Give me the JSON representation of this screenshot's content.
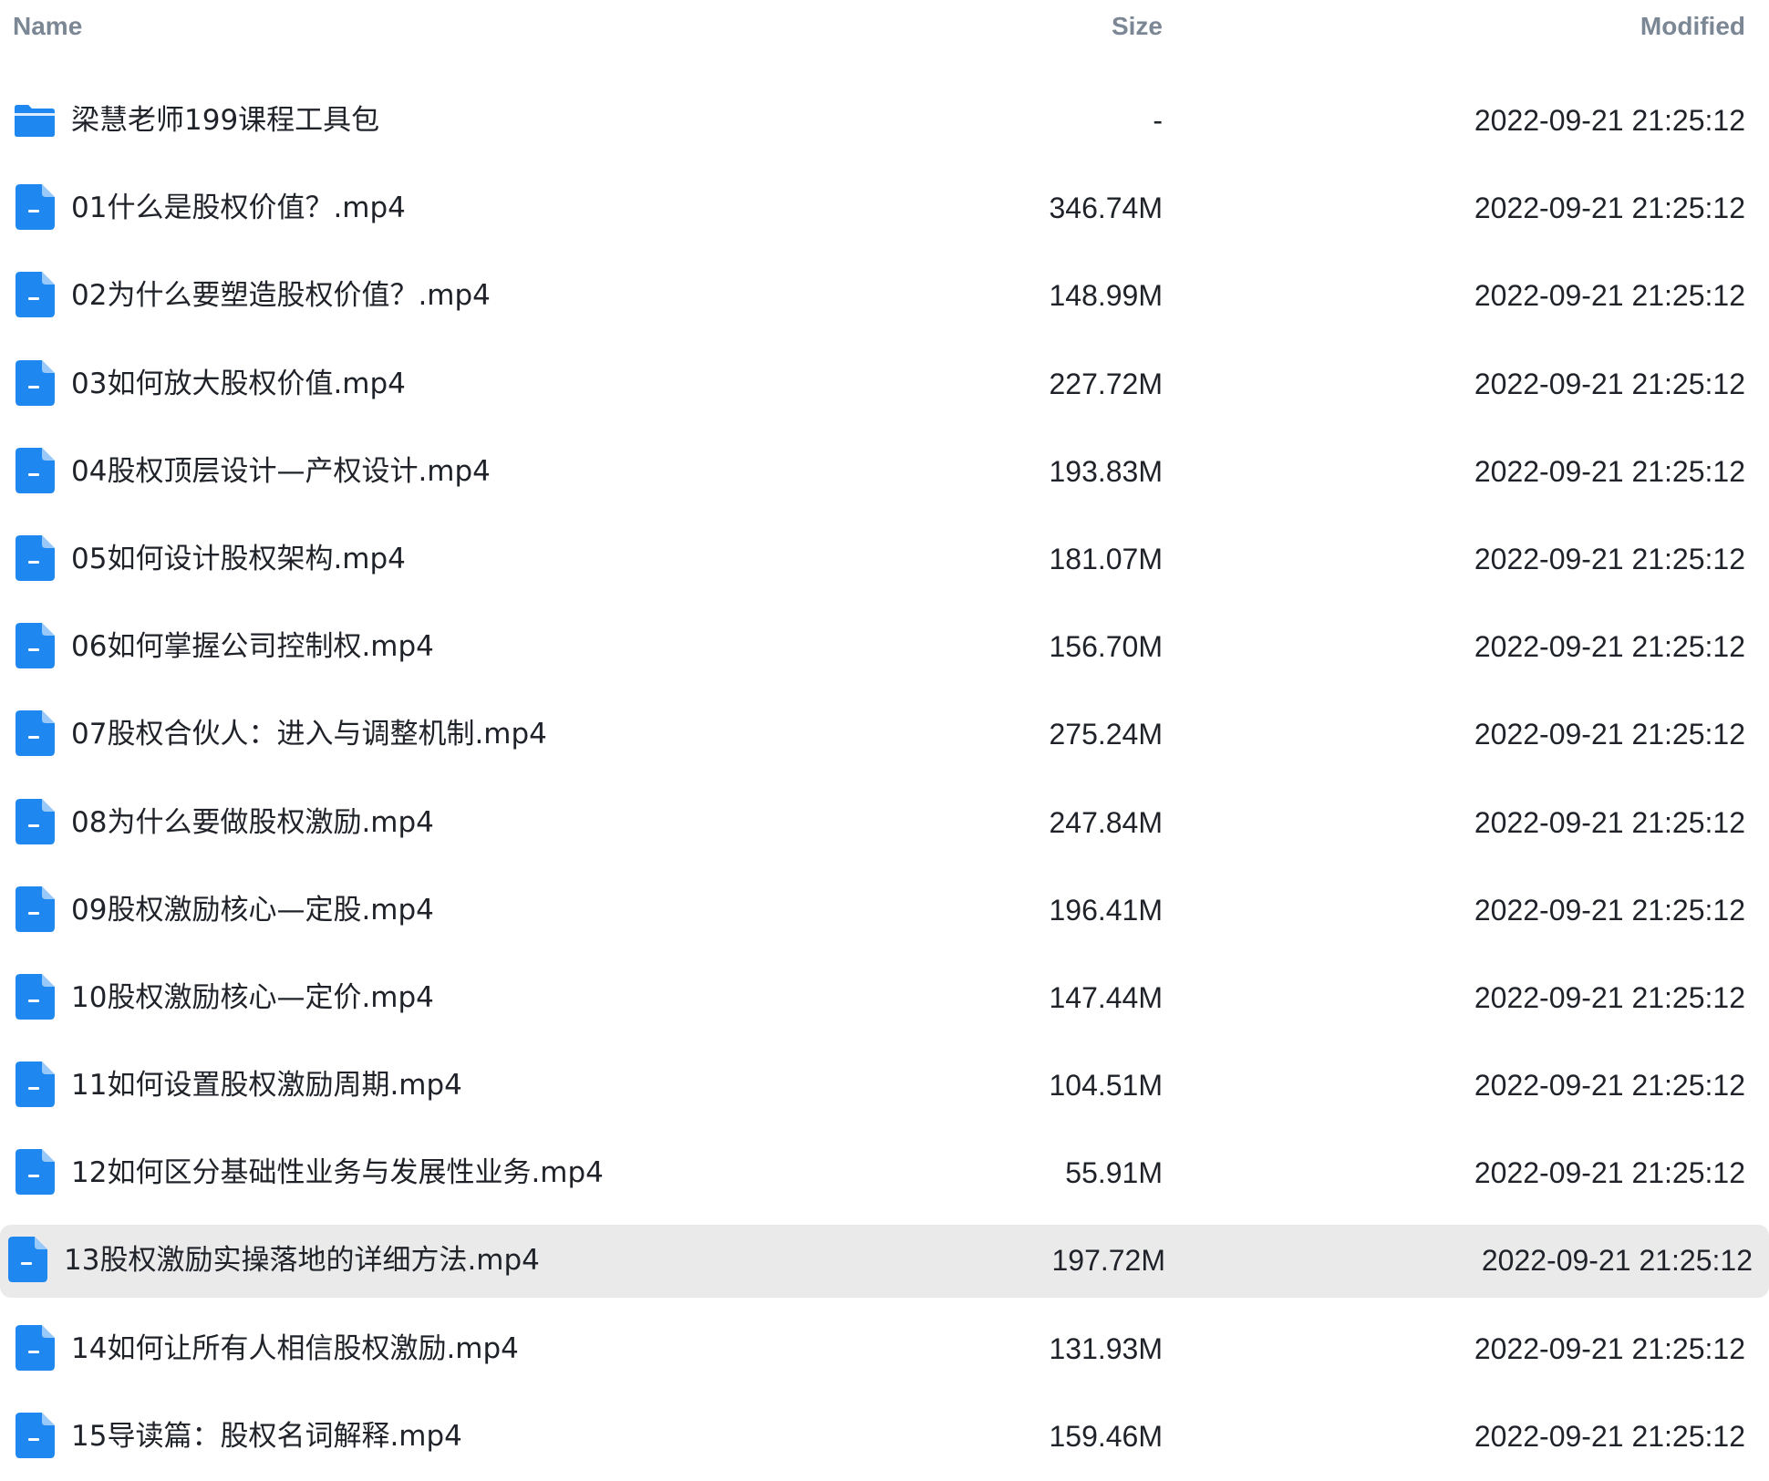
{
  "header": {
    "name": "Name",
    "size": "Size",
    "modified": "Modified"
  },
  "colors": {
    "icon_blue": "#1e88f0",
    "selected_row_bg": "#eaeaeb",
    "header_text": "#7b8794"
  },
  "files": [
    {
      "type": "folder",
      "icon": "folder-icon",
      "name": "梁慧老师199课程工具包",
      "size": "-",
      "modified": "2022-09-21 21:25:12",
      "selected": false
    },
    {
      "type": "file",
      "icon": "document-icon",
      "name": "01什么是股权价值？.mp4",
      "size": "346.74M",
      "modified": "2022-09-21 21:25:12",
      "selected": false
    },
    {
      "type": "file",
      "icon": "document-icon",
      "name": "02为什么要塑造股权价值？.mp4",
      "size": "148.99M",
      "modified": "2022-09-21 21:25:12",
      "selected": false
    },
    {
      "type": "file",
      "icon": "document-icon",
      "name": "03如何放大股权价值.mp4",
      "size": "227.72M",
      "modified": "2022-09-21 21:25:12",
      "selected": false
    },
    {
      "type": "file",
      "icon": "document-icon",
      "name": "04股权顶层设计—产权设计.mp4",
      "size": "193.83M",
      "modified": "2022-09-21 21:25:12",
      "selected": false
    },
    {
      "type": "file",
      "icon": "document-icon",
      "name": "05如何设计股权架构.mp4",
      "size": "181.07M",
      "modified": "2022-09-21 21:25:12",
      "selected": false
    },
    {
      "type": "file",
      "icon": "document-icon",
      "name": "06如何掌握公司控制权.mp4",
      "size": "156.70M",
      "modified": "2022-09-21 21:25:12",
      "selected": false
    },
    {
      "type": "file",
      "icon": "document-icon",
      "name": "07股权合伙人：进入与调整机制.mp4",
      "size": "275.24M",
      "modified": "2022-09-21 21:25:12",
      "selected": false
    },
    {
      "type": "file",
      "icon": "document-icon",
      "name": "08为什么要做股权激励.mp4",
      "size": "247.84M",
      "modified": "2022-09-21 21:25:12",
      "selected": false
    },
    {
      "type": "file",
      "icon": "document-icon",
      "name": "09股权激励核心—定股.mp4",
      "size": "196.41M",
      "modified": "2022-09-21 21:25:12",
      "selected": false
    },
    {
      "type": "file",
      "icon": "document-icon",
      "name": "10股权激励核心—定价.mp4",
      "size": "147.44M",
      "modified": "2022-09-21 21:25:12",
      "selected": false
    },
    {
      "type": "file",
      "icon": "document-icon",
      "name": "11如何设置股权激励周期.mp4",
      "size": "104.51M",
      "modified": "2022-09-21 21:25:12",
      "selected": false
    },
    {
      "type": "file",
      "icon": "document-icon",
      "name": "12如何区分基础性业务与发展性业务.mp4",
      "size": "55.91M",
      "modified": "2022-09-21 21:25:12",
      "selected": false
    },
    {
      "type": "file",
      "icon": "document-icon",
      "name": "13股权激励实操落地的详细方法.mp4",
      "size": "197.72M",
      "modified": "2022-09-21 21:25:12",
      "selected": true
    },
    {
      "type": "file",
      "icon": "document-icon",
      "name": "14如何让所有人相信股权激励.mp4",
      "size": "131.93M",
      "modified": "2022-09-21 21:25:12",
      "selected": false
    },
    {
      "type": "file",
      "icon": "document-icon",
      "name": "15导读篇：股权名词解释.mp4",
      "size": "159.46M",
      "modified": "2022-09-21 21:25:12",
      "selected": false
    }
  ]
}
